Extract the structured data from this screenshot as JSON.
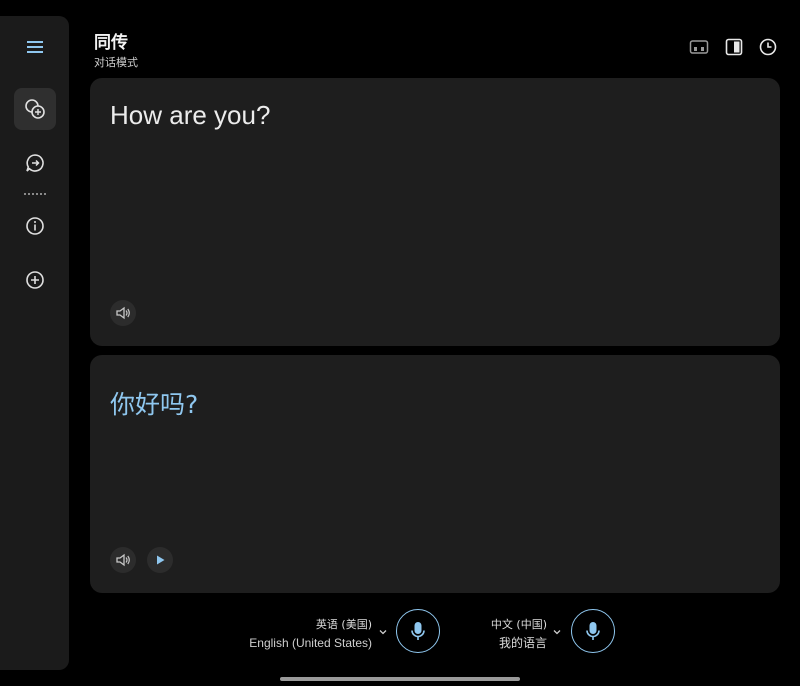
{
  "header": {
    "title": "同传",
    "subtitle": "对话模式"
  },
  "source": {
    "text": "How are you?"
  },
  "translation": {
    "text": "你好吗?"
  },
  "languages": {
    "left": {
      "name": "英语 (美国)",
      "native": "English (United States)"
    },
    "right": {
      "name": "中文 (中国)",
      "label": "我的语言"
    }
  },
  "icons": {
    "menu": "menu-icon",
    "conversation": "conversation-icon",
    "chat": "chat-bubble-icon",
    "info": "info-icon",
    "add": "add-icon",
    "dual_screen": "dual-screen-icon",
    "split_view": "split-view-icon",
    "history": "history-icon",
    "speaker": "speaker-icon",
    "play": "play-icon",
    "mic": "microphone-icon"
  },
  "colors": {
    "accent": "#8fc7ef",
    "background": "#000000",
    "card": "#1e1e1e",
    "rail": "#1b1b1b"
  }
}
